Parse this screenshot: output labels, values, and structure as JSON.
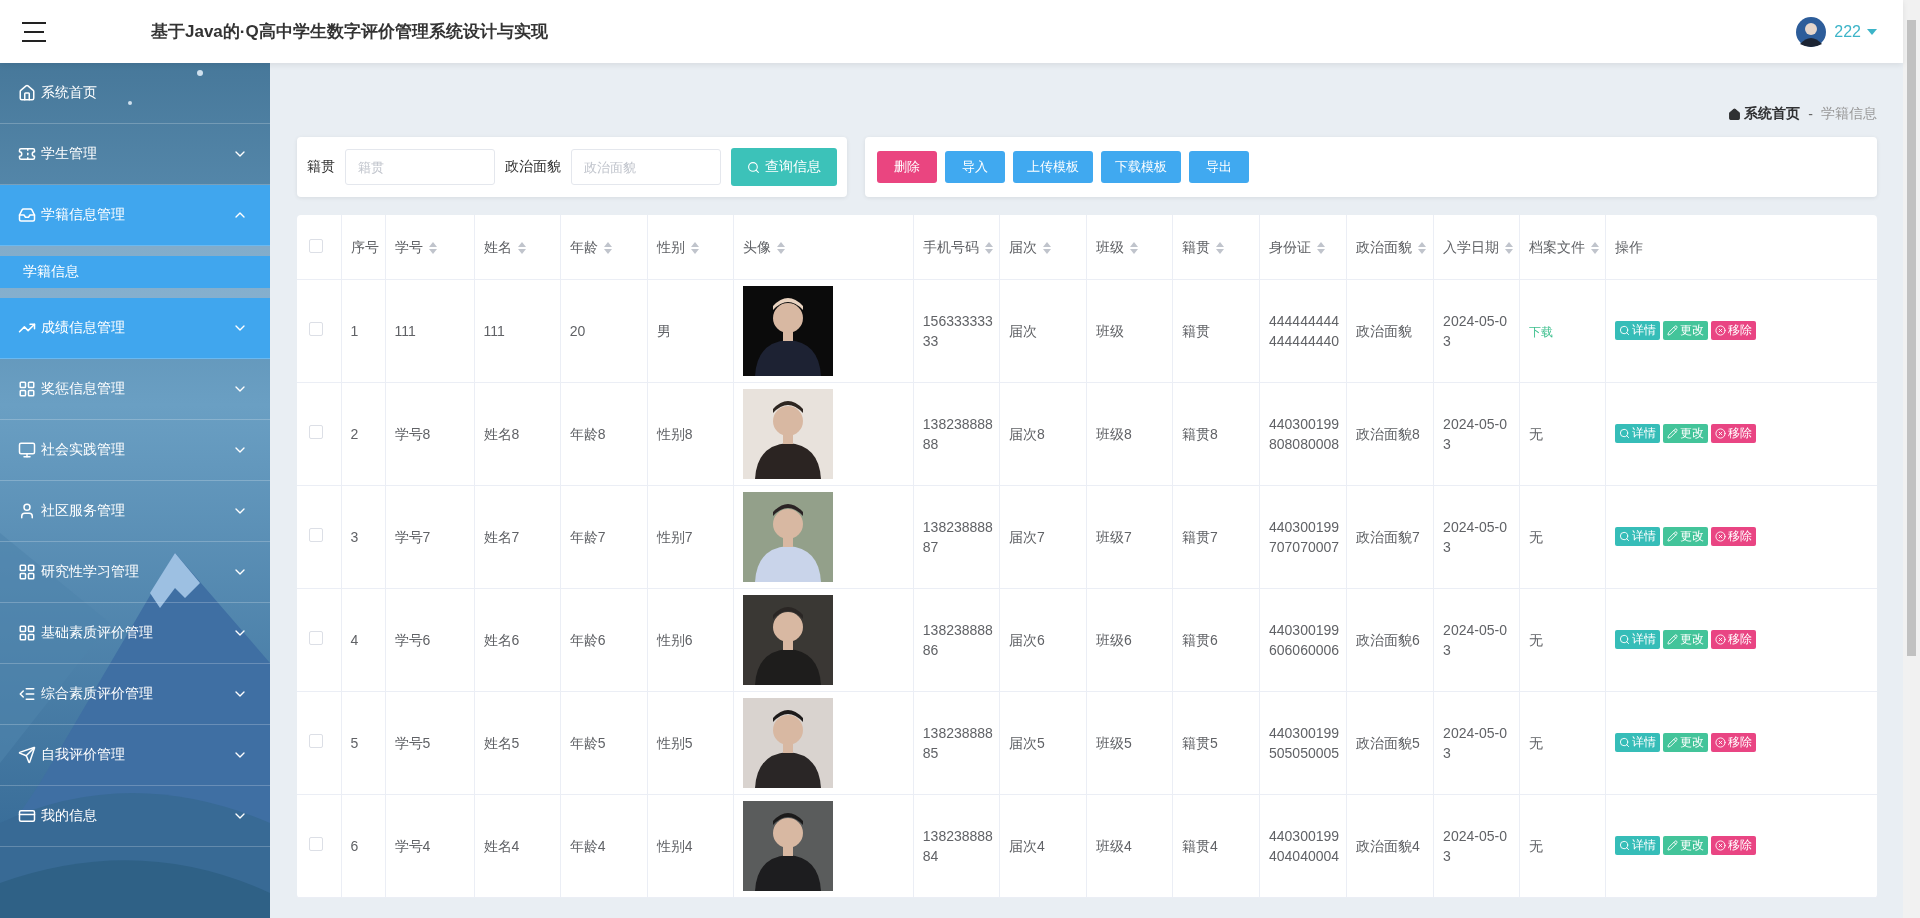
{
  "header": {
    "title": "基于Java的·Q高中学生数字评价管理系统设计与实现",
    "user": {
      "name": "222"
    }
  },
  "sidebar": {
    "items": [
      {
        "label": "系统首页",
        "highlighted": false,
        "has_children": false
      },
      {
        "label": "学生管理",
        "expanded": false,
        "highlighted": false,
        "has_children": true
      },
      {
        "label": "学籍信息管理",
        "expanded": true,
        "highlighted": true,
        "has_children": true,
        "children": [
          {
            "label": "学籍信息",
            "selected": true
          }
        ]
      },
      {
        "label": "成绩信息管理",
        "expanded": false,
        "highlighted": true,
        "has_children": true
      },
      {
        "label": "奖惩信息管理",
        "expanded": false,
        "highlighted": false,
        "has_children": true
      },
      {
        "label": "社会实践管理",
        "expanded": false,
        "highlighted": false,
        "has_children": true
      },
      {
        "label": "社区服务管理",
        "expanded": false,
        "highlighted": false,
        "has_children": true
      },
      {
        "label": "研究性学习管理",
        "expanded": false,
        "highlighted": false,
        "has_children": true
      },
      {
        "label": "基础素质评价管理",
        "expanded": false,
        "highlighted": false,
        "has_children": true
      },
      {
        "label": "综合素质评价管理",
        "expanded": false,
        "highlighted": false,
        "has_children": true
      },
      {
        "label": "自我评价管理",
        "expanded": false,
        "highlighted": false,
        "has_children": true
      },
      {
        "label": "我的信息",
        "expanded": false,
        "highlighted": false,
        "has_children": true
      }
    ]
  },
  "breadcrumb": {
    "home": "系统首页",
    "separator": "-",
    "current": "学籍信息"
  },
  "filters": [
    {
      "label": "籍贯",
      "placeholder": "籍贯"
    },
    {
      "label": "政治面貌",
      "placeholder": "政治面貌"
    }
  ],
  "query_button": "查询信息",
  "actions": [
    {
      "label": "删除",
      "kind": "danger"
    },
    {
      "label": "导入",
      "kind": "primary"
    },
    {
      "label": "上传模板",
      "kind": "primary"
    },
    {
      "label": "下载模板",
      "kind": "primary"
    },
    {
      "label": "导出",
      "kind": "primary"
    }
  ],
  "table": {
    "select_all": {
      "checked": false
    },
    "columns": [
      {
        "label": "序号",
        "sortable": false
      },
      {
        "label": "学号",
        "sortable": true
      },
      {
        "label": "姓名",
        "sortable": true
      },
      {
        "label": "年龄",
        "sortable": true
      },
      {
        "label": "性别",
        "sortable": true
      },
      {
        "label": "头像",
        "sortable": true
      },
      {
        "label": "手机号码",
        "sortable": true
      },
      {
        "label": "届次",
        "sortable": true
      },
      {
        "label": "班级",
        "sortable": true
      },
      {
        "label": "籍贯",
        "sortable": true
      },
      {
        "label": "身份证",
        "sortable": true
      },
      {
        "label": "政治面貌",
        "sortable": true
      },
      {
        "label": "入学日期",
        "sortable": true
      },
      {
        "label": "档案文件",
        "sortable": true
      },
      {
        "label": "操作",
        "sortable": false
      }
    ],
    "rows": [
      {
        "checked": false,
        "cells": [
          "1",
          "111",
          "111",
          "20",
          "男",
          {
            "kind": "picture"
          },
          "15633333333",
          "届次",
          "班级",
          "籍贯",
          "444444444444444440",
          "政治面貌",
          "2024-05-03",
          {
            "kind": "link",
            "text": "下载"
          },
          {
            "kind": "actions",
            "buttons": [
              {
                "label": "详情",
                "kind": "info"
              },
              {
                "label": "更改",
                "kind": "edit"
              },
              {
                "label": "移除",
                "kind": "danger"
              }
            ]
          }
        ]
      },
      {
        "checked": false,
        "cells": [
          "2",
          "学号8",
          "姓名8",
          "年龄8",
          "性别8",
          {
            "kind": "picture"
          },
          "13823888888",
          "届次8",
          "班级8",
          "籍贯8",
          "440300199808080008",
          "政治面貌8",
          "2024-05-03",
          "无",
          {
            "kind": "actions",
            "buttons": [
              {
                "label": "详情",
                "kind": "info"
              },
              {
                "label": "更改",
                "kind": "edit"
              },
              {
                "label": "移除",
                "kind": "danger"
              }
            ]
          }
        ]
      },
      {
        "checked": false,
        "cells": [
          "3",
          "学号7",
          "姓名7",
          "年龄7",
          "性别7",
          {
            "kind": "picture"
          },
          "13823888887",
          "届次7",
          "班级7",
          "籍贯7",
          "440300199707070007",
          "政治面貌7",
          "2024-05-03",
          "无",
          {
            "kind": "actions",
            "buttons": [
              {
                "label": "详情",
                "kind": "info"
              },
              {
                "label": "更改",
                "kind": "edit"
              },
              {
                "label": "移除",
                "kind": "danger"
              }
            ]
          }
        ]
      },
      {
        "checked": false,
        "cells": [
          "4",
          "学号6",
          "姓名6",
          "年龄6",
          "性别6",
          {
            "kind": "picture"
          },
          "13823888886",
          "届次6",
          "班级6",
          "籍贯6",
          "440300199606060006",
          "政治面貌6",
          "2024-05-03",
          "无",
          {
            "kind": "actions",
            "buttons": [
              {
                "label": "详情",
                "kind": "info"
              },
              {
                "label": "更改",
                "kind": "edit"
              },
              {
                "label": "移除",
                "kind": "danger"
              }
            ]
          }
        ]
      },
      {
        "checked": false,
        "cells": [
          "5",
          "学号5",
          "姓名5",
          "年龄5",
          "性别5",
          {
            "kind": "picture"
          },
          "13823888885",
          "届次5",
          "班级5",
          "籍贯5",
          "440300199505050005",
          "政治面貌5",
          "2024-05-03",
          "无",
          {
            "kind": "actions",
            "buttons": [
              {
                "label": "详情",
                "kind": "info"
              },
              {
                "label": "更改",
                "kind": "edit"
              },
              {
                "label": "移除",
                "kind": "danger"
              }
            ]
          }
        ]
      },
      {
        "checked": false,
        "cells": [
          "6",
          "学号4",
          "姓名4",
          "年龄4",
          "性别4",
          {
            "kind": "picture"
          },
          "13823888884",
          "届次4",
          "班级4",
          "籍贯4",
          "440300199404040004",
          "政治面貌4",
          "2024-05-03",
          "无",
          {
            "kind": "actions",
            "buttons": [
              {
                "label": "详情",
                "kind": "info"
              },
              {
                "label": "更改",
                "kind": "edit"
              },
              {
                "label": "移除",
                "kind": "danger"
              }
            ]
          }
        ]
      }
    ]
  }
}
